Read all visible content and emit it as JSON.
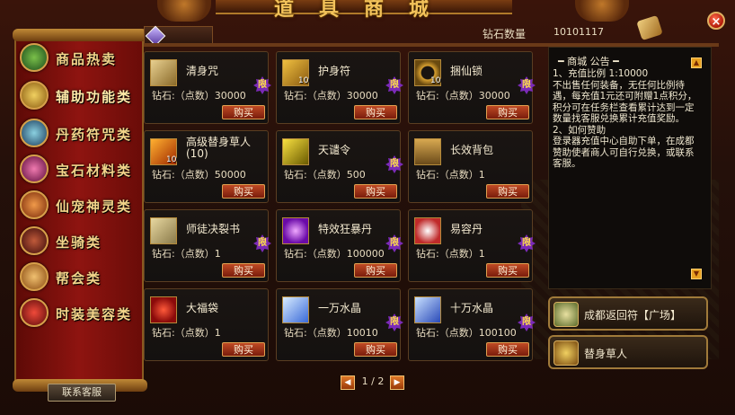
{
  "header": {
    "title": "道具商城",
    "balance_label": "钻石数量",
    "balance_value": "10101117",
    "close_icon": "×"
  },
  "sidebar": {
    "items": [
      {
        "label": "商品热卖",
        "icon": "treasure-chest-icon",
        "color": "#3a7a2a"
      },
      {
        "label": "辅助功能类",
        "icon": "scroll-book-icon",
        "color": "#c89a2a"
      },
      {
        "label": "丹药符咒类",
        "icon": "elixir-orb-icon",
        "color": "#2a6a8a"
      },
      {
        "label": "宝石材料类",
        "icon": "gem-icon",
        "color": "#b02a6a"
      },
      {
        "label": "仙宠神灵类",
        "icon": "spirit-pet-icon",
        "color": "#c8481a"
      },
      {
        "label": "坐骑类",
        "icon": "mount-icon",
        "color": "#6a2a1a"
      },
      {
        "label": "帮会类",
        "icon": "guild-icon",
        "color": "#c87a2a"
      },
      {
        "label": "时装美容类",
        "icon": "fashion-icon",
        "color": "#b01a1a"
      }
    ],
    "contact_label": "联系客服"
  },
  "goods": {
    "buy_label": "购买",
    "limit_label": "限",
    "items": [
      {
        "name": "清身咒",
        "price": "钻石:（点数）30000",
        "count": "",
        "limit": true,
        "icon_color": "#c8a85a"
      },
      {
        "name": "护身符",
        "price": "钻石:（点数）30000",
        "count": "10",
        "limit": true,
        "icon_color": "#d8a020"
      },
      {
        "name": "捆仙锁",
        "price": "钻石:（点数）30000",
        "count": "10",
        "limit": true,
        "icon_color": "#c8a030"
      },
      {
        "name": "高级替身草人(10)",
        "price": "钻石:（点数）50000",
        "count": "10",
        "limit": false,
        "icon_color": "#e06a10"
      },
      {
        "name": "天谴令",
        "price": "钻石:（点数）500",
        "count": "",
        "limit": true,
        "icon_color": "#e8c020"
      },
      {
        "name": "长效背包",
        "price": "钻石:（点数）1",
        "count": "",
        "limit": false,
        "icon_color": "#a07a3a"
      },
      {
        "name": "师徒决裂书",
        "price": "钻石:（点数）1",
        "count": "",
        "limit": true,
        "icon_color": "#d0b070"
      },
      {
        "name": "特效狂暴丹",
        "price": "钻石:（点数）100000",
        "count": "",
        "limit": true,
        "icon_color": "#9a3ad8"
      },
      {
        "name": "易容丹",
        "price": "钻石:（点数）1",
        "count": "",
        "limit": true,
        "icon_color": "#d8d8e8"
      },
      {
        "name": "大福袋",
        "price": "钻石:（点数）1",
        "count": "",
        "limit": false,
        "icon_color": "#d02a10"
      },
      {
        "name": "一万水晶",
        "price": "钻石:（点数）10010",
        "count": "",
        "limit": true,
        "icon_color": "#7ab0ff"
      },
      {
        "name": "十万水晶",
        "price": "钻石:（点数）100100",
        "count": "",
        "limit": true,
        "icon_color": "#5a90ff"
      }
    ]
  },
  "pager": {
    "prev_icon": "◀",
    "next_icon": "▶",
    "text": "1 / 2"
  },
  "notice": {
    "title": "━ 商城 公告 ━",
    "lines": [
      "1、充值比例 1:10000",
      "不出售任何装备，无任何比例待遇，每充值1元还可附赠1点积分，积分可在任务栏查看累计达到一定数量找客服兑换累计充值奖励。",
      "2、如何赞助",
      "登录器充值中心自助下单，在成都赞助使者商人可自行兑换，或联系客服。"
    ],
    "scroll_up_icon": "▲",
    "scroll_down_icon": "▼"
  },
  "quick_buttons": [
    {
      "label": "成都返回符【广场】",
      "icon": "return-talisman-icon",
      "icon_color": "#8a9a4a"
    },
    {
      "label": "替身草人",
      "icon": "straw-doll-icon",
      "icon_color": "#c8a040"
    }
  ]
}
